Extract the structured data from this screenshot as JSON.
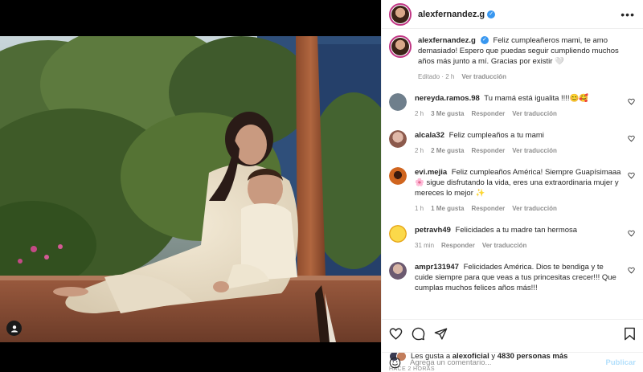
{
  "header": {
    "username": "alexfernandez.g",
    "verified": true,
    "more_icon": "more-horizontal-icon"
  },
  "caption": {
    "username": "alexfernandez.g",
    "text": "Feliz cumpleañeros mami, te amo demasiado! Espero que puedas seguir cumpliendo muchos años más junto a mí. Gracias por existir 🤍",
    "edited": "Editado",
    "time": "2 h",
    "translate": "Ver traducción"
  },
  "comments": [
    {
      "username": "nereyda.ramos.98",
      "text": "Tu mamá está igualita !!!!😊🥰",
      "time": "2 h",
      "likes": "3 Me gusta",
      "reply": "Responder",
      "translate": "Ver traducción",
      "avatar_color": "#6f7f8c"
    },
    {
      "username": "alcala32",
      "text": "Feliz cumpleaños a tu mami",
      "time": "2 h",
      "likes": "2 Me gusta",
      "reply": "Responder",
      "translate": "Ver traducción",
      "avatar_color": "#b58e86"
    },
    {
      "username": "evi.mejia",
      "text": "Feliz cumpleaños América! Siempre Guapísimaaa 🌸 sigue disfrutando la vida, eres una extraordinaria mujer y mereces lo mejor ✨",
      "time": "1 h",
      "likes": "1 Me gusta",
      "reply": "Responder",
      "translate": "Ver traducción",
      "avatar_color": "#c0552a"
    },
    {
      "username": "petravh49",
      "text": "Felicidades a tu madre tan hermosa",
      "time": "31 min",
      "likes": "",
      "reply": "Responder",
      "translate": "Ver traducción",
      "avatar_color": "#f5c12e"
    },
    {
      "username": "ampr131947",
      "text": "Felicidades América. Dios te bendiga y te cuide siempre para que veas a tus princesitas crecer!!! Que cumplas muchos felices años más!!!",
      "time": "",
      "likes": "",
      "reply": "",
      "translate": "",
      "avatar_color": "#8a7f95"
    }
  ],
  "actions": {
    "like_icon": "heart-icon",
    "comment_icon": "comment-icon",
    "share_icon": "send-icon",
    "save_icon": "bookmark-icon"
  },
  "likes": {
    "prefix": "Les gusta a",
    "user": "alexoficial",
    "joiner": "y",
    "others": "4830 personas más"
  },
  "timestamp": "HACE 2 HORAS",
  "composer": {
    "placeholder": "Agrega un comentario...",
    "publish": "Publicar",
    "emoji_icon": "emoji-icon"
  },
  "colors": {
    "verified": "#3897f0",
    "publish": "#b2dffc",
    "muted": "#8e8e8e"
  }
}
